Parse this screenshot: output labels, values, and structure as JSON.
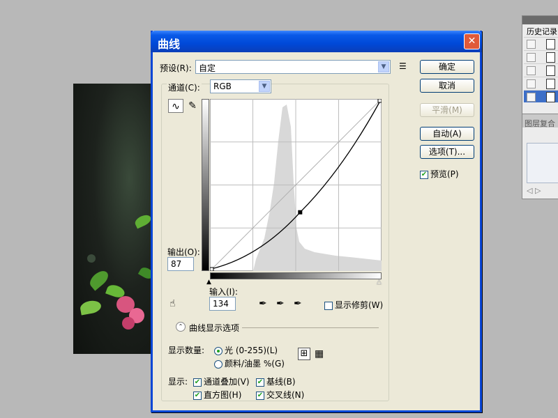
{
  "dialog": {
    "title": "曲线",
    "preset_label": "预设(R):",
    "preset_value": "自定",
    "channel_label": "通道(C):",
    "channel_value": "RGB",
    "output_label": "输出(O):",
    "output_value": "87",
    "input_label": "输入(I):",
    "input_value": "134",
    "show_clipping_label": "显示修剪(W)",
    "curve_options_label": "曲线显示选项",
    "show_amount_label": "显示数量:",
    "light_label": "光 (0-255)(L)",
    "pigment_label": "颜料/油墨 %(G)",
    "show_label": "显示:",
    "channel_overlay_label": "通道叠加(V)",
    "baseline_label": "基线(B)",
    "histogram_label": "直方图(H)",
    "crosshair_label": "交叉线(N)",
    "preview_label": "预览(P)"
  },
  "buttons": {
    "ok": "确定",
    "cancel": "取消",
    "smooth": "平滑(M)",
    "auto": "自动(A)",
    "options": "选项(T)..."
  },
  "history_panel": {
    "tab": "历史记录",
    "layer_comp_tab": "图层复合"
  },
  "curve": {
    "point_input": 134,
    "point_output": 87,
    "channel": "RGB"
  }
}
